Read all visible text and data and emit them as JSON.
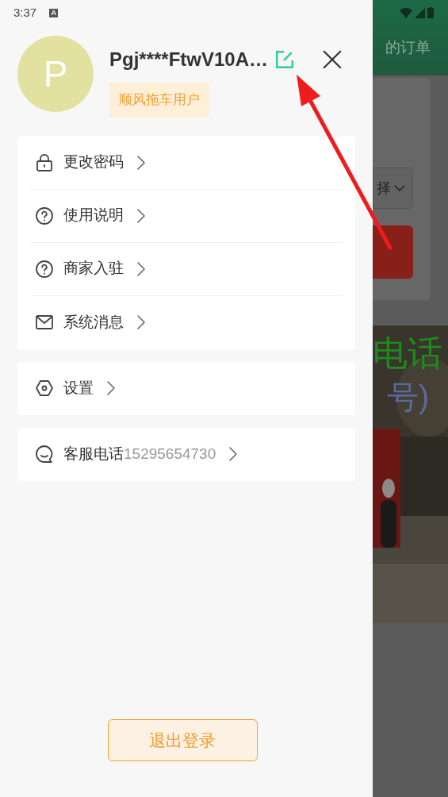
{
  "status_bar": {
    "time": "3:37",
    "notification_icon": "A"
  },
  "profile": {
    "avatar_letter": "P",
    "username": "Pgj****FtwV10A…",
    "badge": "顺风拖车用户"
  },
  "menu_groups": [
    {
      "items": [
        {
          "kind": "lock",
          "label": "更改密码"
        },
        {
          "kind": "help",
          "label": "使用说明"
        },
        {
          "kind": "help",
          "label": "商家入驻"
        },
        {
          "kind": "mail",
          "label": "系统消息"
        }
      ]
    },
    {
      "items": [
        {
          "kind": "settings",
          "label": "设置"
        }
      ]
    },
    {
      "items": [
        {
          "kind": "chat",
          "label": "客服电话",
          "value": "15295654730"
        }
      ]
    }
  ],
  "logout_button": "退出登录",
  "background": {
    "header_title": "的订单",
    "dropdown_text": "择",
    "banner_line_1": "电话",
    "banner_line_2": "号)"
  }
}
